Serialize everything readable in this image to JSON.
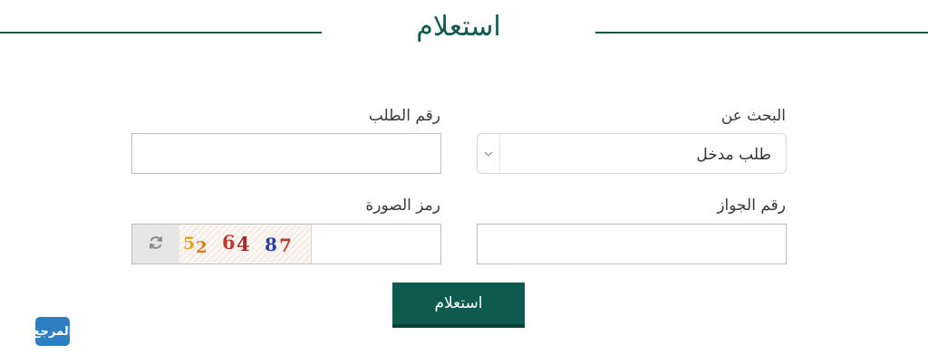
{
  "header": {
    "title": "استعلام"
  },
  "form": {
    "search_by": {
      "label": "البحث عن",
      "selected": "طلب مدخل"
    },
    "request_number": {
      "label": "رقم الطلب",
      "value": ""
    },
    "passport_number": {
      "label": "رقم الجواز",
      "value": ""
    },
    "captcha": {
      "label": "رمز الصورة",
      "value": "",
      "digits": [
        {
          "text": "5",
          "color": "#e6a21c"
        },
        {
          "text": "2",
          "color": "#e07a16"
        },
        {
          "text": "6",
          "color": "#c0392b"
        },
        {
          "text": "4",
          "color": "#a52a2a"
        },
        {
          "text": "8",
          "color": "#2c3e9e"
        },
        {
          "text": "7",
          "color": "#c0392b"
        }
      ]
    },
    "submit_label": "استعلام"
  },
  "logo": {
    "text": "المرجع"
  },
  "colors": {
    "accent": "#0f5a4e",
    "logo": "#2d7fc1"
  }
}
